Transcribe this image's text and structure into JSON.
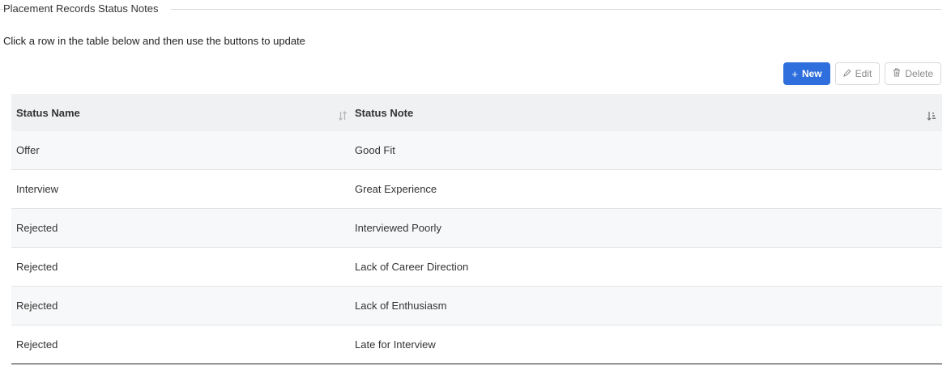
{
  "section": {
    "legend": "Placement Records Status Notes",
    "instructions": "Click a row in the table below and then use the buttons to update"
  },
  "toolbar": {
    "new_label": "New",
    "edit_label": "Edit",
    "delete_label": "Delete",
    "accent_color": "#2f6fdd"
  },
  "table": {
    "columns": [
      "Status Name",
      "Status Note"
    ],
    "sort": {
      "Status Name": "unsorted",
      "Status Note": "ascending"
    },
    "rows": [
      {
        "status_name": "Offer",
        "status_note": "Good Fit"
      },
      {
        "status_name": "Interview",
        "status_note": "Great Experience"
      },
      {
        "status_name": "Rejected",
        "status_note": "Interviewed Poorly"
      },
      {
        "status_name": "Rejected",
        "status_note": "Lack of Career Direction"
      },
      {
        "status_name": "Rejected",
        "status_note": "Lack of Enthusiasm"
      },
      {
        "status_name": "Rejected",
        "status_note": "Late for Interview"
      }
    ]
  }
}
